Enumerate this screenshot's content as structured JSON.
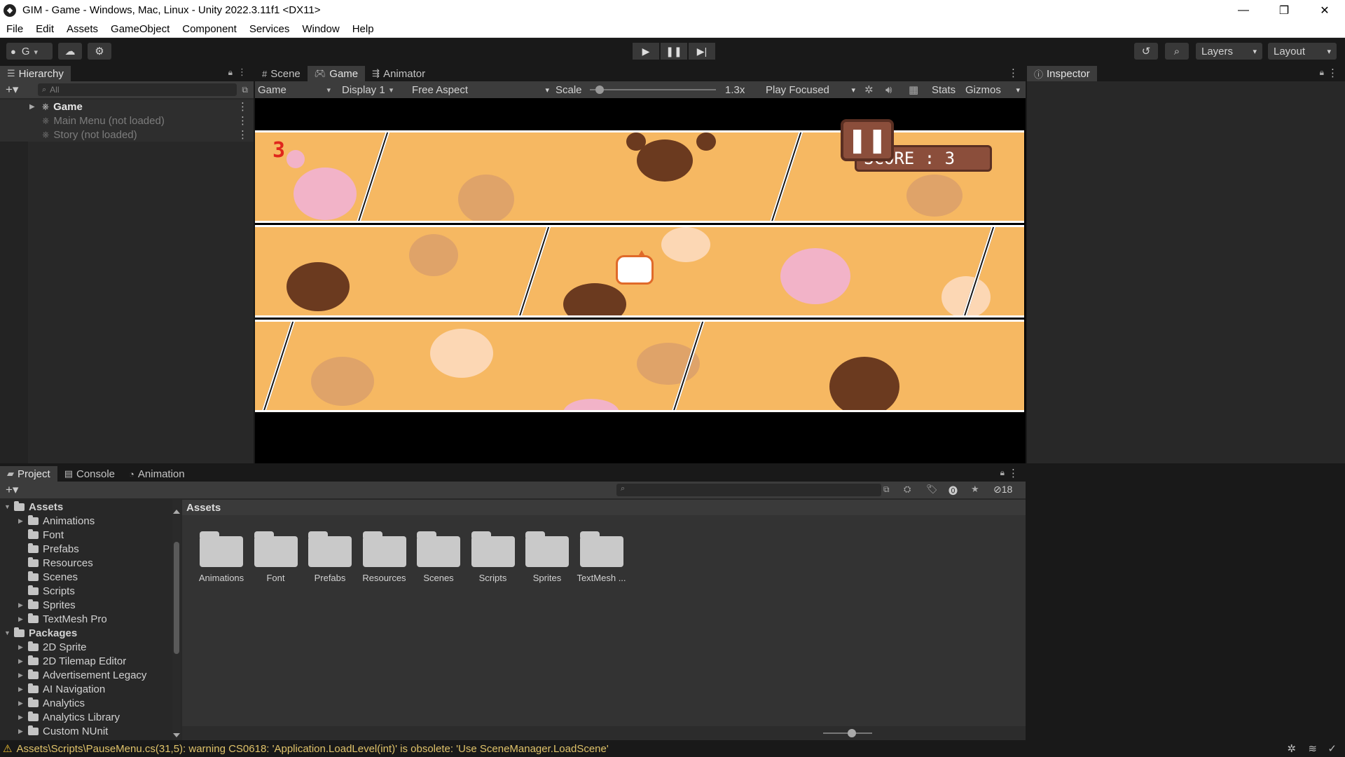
{
  "window": {
    "title": "GIM - Game - Windows, Mac, Linux - Unity 2022.3.11f1 <DX11>"
  },
  "menu": [
    "File",
    "Edit",
    "Assets",
    "GameObject",
    "Component",
    "Services",
    "Window",
    "Help"
  ],
  "toolbar": {
    "account": "G",
    "layers": "Layers",
    "layout": "Layout"
  },
  "hierarchy": {
    "tab": "Hierarchy",
    "search_placeholder": "All",
    "items": [
      {
        "label": "Game"
      },
      {
        "label": "Main Menu (not loaded)"
      },
      {
        "label": "Story (not loaded)"
      }
    ]
  },
  "center_tabs": {
    "scene": "Scene",
    "game": "Game",
    "animator": "Animator"
  },
  "game_bar": {
    "mode": "Game",
    "display": "Display 1",
    "aspect": "Free Aspect",
    "scale_label": "Scale",
    "scale_value": 0.05,
    "scale_text": "1.3x",
    "play_focused": "Play Focused",
    "stats": "Stats",
    "gizmos": "Gizmos"
  },
  "game": {
    "counter": "3",
    "score": "SCORE : 3"
  },
  "inspector": {
    "tab": "Inspector"
  },
  "bottom_tabs": {
    "project": "Project",
    "console": "Console",
    "animation": "Animation"
  },
  "project": {
    "hidden_count": "18",
    "breadcrumb": "Assets",
    "zoom_slider_value": 0.6,
    "tree": [
      {
        "label": "Assets",
        "level": 0,
        "bold": true,
        "expanded": true
      },
      {
        "label": "Animations",
        "level": 1,
        "arrow": true
      },
      {
        "label": "Font",
        "level": 1
      },
      {
        "label": "Prefabs",
        "level": 1
      },
      {
        "label": "Resources",
        "level": 1
      },
      {
        "label": "Scenes",
        "level": 1
      },
      {
        "label": "Scripts",
        "level": 1
      },
      {
        "label": "Sprites",
        "level": 1,
        "arrow": true
      },
      {
        "label": "TextMesh Pro",
        "level": 1,
        "arrow": true
      },
      {
        "label": "Packages",
        "level": 0,
        "bold": true,
        "expanded": true
      },
      {
        "label": "2D Sprite",
        "level": 1,
        "arrow": true
      },
      {
        "label": "2D Tilemap Editor",
        "level": 1,
        "arrow": true
      },
      {
        "label": "Advertisement Legacy",
        "level": 1,
        "arrow": true
      },
      {
        "label": "AI Navigation",
        "level": 1,
        "arrow": true
      },
      {
        "label": "Analytics",
        "level": 1,
        "arrow": true
      },
      {
        "label": "Analytics Library",
        "level": 1,
        "arrow": true
      },
      {
        "label": "Custom NUnit",
        "level": 1,
        "arrow": true
      }
    ],
    "folders": [
      "Animations",
      "Font",
      "Prefabs",
      "Resources",
      "Scenes",
      "Scripts",
      "Sprites",
      "TextMesh ..."
    ]
  },
  "status": {
    "message": "Assets\\Scripts\\PauseMenu.cs(31,5): warning CS0618: 'Application.LoadLevel(int)' is obsolete: 'Use SceneManager.LoadScene'"
  },
  "colors": {
    "lane": "#f6b862",
    "paw_dark": "#6b3a1f",
    "paw_pink": "#f2b3c8",
    "counter_red": "#e0261c",
    "score_box": "#8b4e3b",
    "warning": "#e0c36a"
  }
}
